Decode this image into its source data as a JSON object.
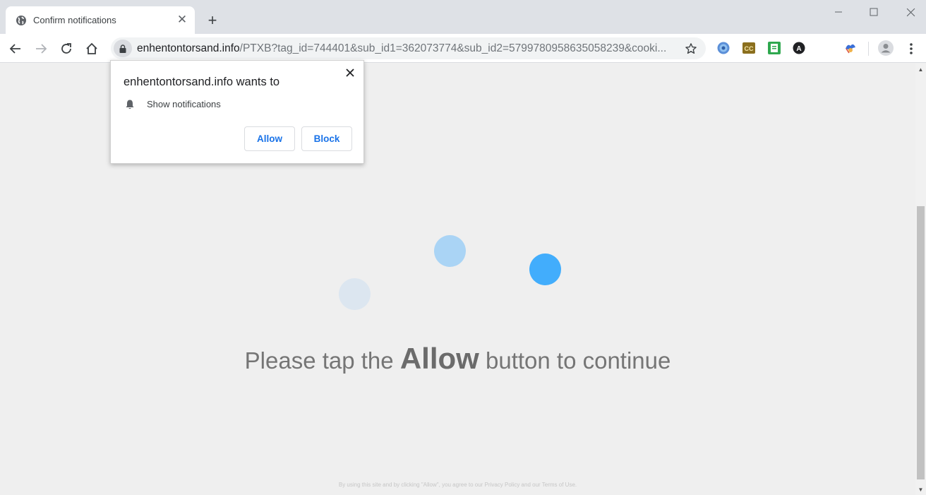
{
  "browser": {
    "tab_title": "Confirm notifications",
    "new_tab_symbol": "+",
    "url_host": "enhentontorsand.info",
    "url_path": "/PTXB?tag_id=744401&sub_id1=362073774&sub_id2=5799780958635058239&cooki..."
  },
  "popup": {
    "title": "enhentontorsand.info wants to",
    "permission": "Show notifications",
    "allow_label": "Allow",
    "block_label": "Block"
  },
  "page": {
    "headline_before": "Please tap the",
    "headline_strong": "Allow",
    "headline_after": "button to continue",
    "footer": "By using this site and by clicking \"Allow\", you agree to our Privacy Policy and our Terms of Use."
  },
  "colors": {
    "accent": "#1a73e8",
    "dot_bright": "#42adfc",
    "dot_light": "#aad4f5",
    "dot_faint": "#dce6f0"
  },
  "icons": {
    "extensions": [
      "hdd-ring-icon",
      "cc-extension-icon",
      "green-sheet-extension-icon",
      "a-circle-extension-icon",
      "jester-extension-icon"
    ]
  }
}
